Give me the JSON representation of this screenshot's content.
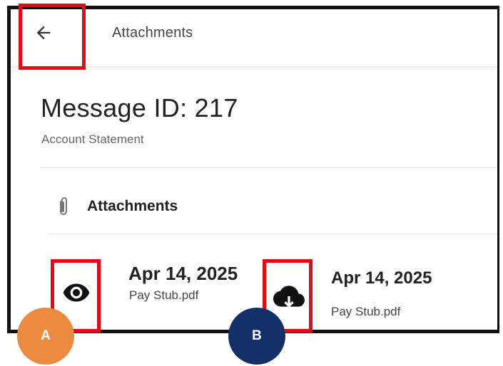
{
  "header": {
    "title": "Attachments",
    "back_icon": "arrow-left-icon"
  },
  "message": {
    "title": "Message ID: 217",
    "subtitle": "Account Statement"
  },
  "attachments_section": {
    "label": "Attachments",
    "icon": "paperclip-icon"
  },
  "files": [
    {
      "date": "Apr 14, 2025",
      "name": "Pay Stub.pdf",
      "action_icon": "eye-icon"
    },
    {
      "date": "Apr 14, 2025",
      "name": "Pay Stub.pdf",
      "action_icon": "cloud-download-icon"
    }
  ],
  "annotations": {
    "badge_a": "A",
    "badge_b": "B",
    "highlight_color": "#e30b17",
    "badge_a_color": "#ec8a3f",
    "badge_b_color": "#13306b"
  }
}
